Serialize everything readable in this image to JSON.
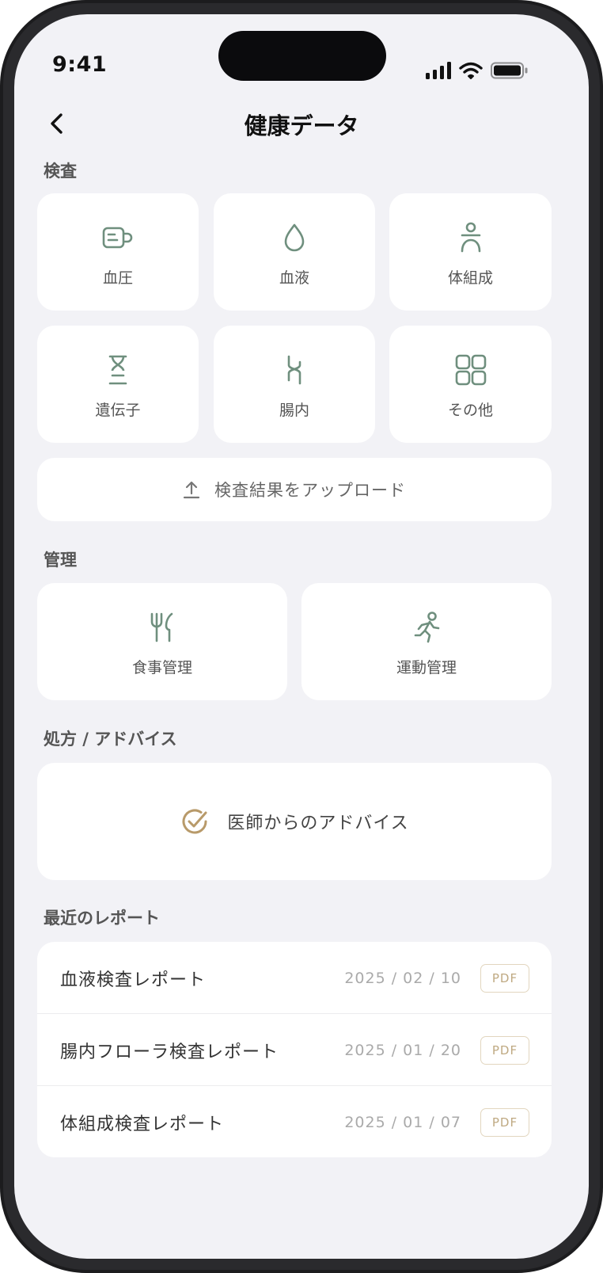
{
  "status_bar": {
    "time": "9:41"
  },
  "header": {
    "title": "健康データ"
  },
  "sections": {
    "tests": {
      "label": "検査",
      "tiles": [
        {
          "label": "血圧",
          "icon": "blood-pressure-icon"
        },
        {
          "label": "血液",
          "icon": "blood-drop-icon"
        },
        {
          "label": "体組成",
          "icon": "body-composition-icon"
        },
        {
          "label": "遺伝子",
          "icon": "dna-icon"
        },
        {
          "label": "腸内",
          "icon": "intestine-icon"
        },
        {
          "label": "その他",
          "icon": "grid-icon"
        }
      ],
      "upload_label": "検査結果をアップロード"
    },
    "management": {
      "label": "管理",
      "tiles": [
        {
          "label": "食事管理",
          "icon": "utensils-icon"
        },
        {
          "label": "運動管理",
          "icon": "running-icon"
        }
      ]
    },
    "prescription": {
      "label": "処方 / アドバイス",
      "advice_label": "医師からのアドバイス"
    },
    "reports": {
      "label": "最近のレポート",
      "items": [
        {
          "name": "血液検査レポート",
          "date": "2025 / 02 / 10",
          "badge": "PDF"
        },
        {
          "name": "腸内フローラ検査レポート",
          "date": "2025 / 01 / 20",
          "badge": "PDF"
        },
        {
          "name": "体組成検査レポート",
          "date": "2025 / 01 / 07",
          "badge": "PDF"
        }
      ]
    }
  },
  "colors": {
    "icon_green": "#6f8f7e",
    "accent_gold": "#b89a6a",
    "background": "#f2f2f6",
    "card": "#ffffff"
  }
}
